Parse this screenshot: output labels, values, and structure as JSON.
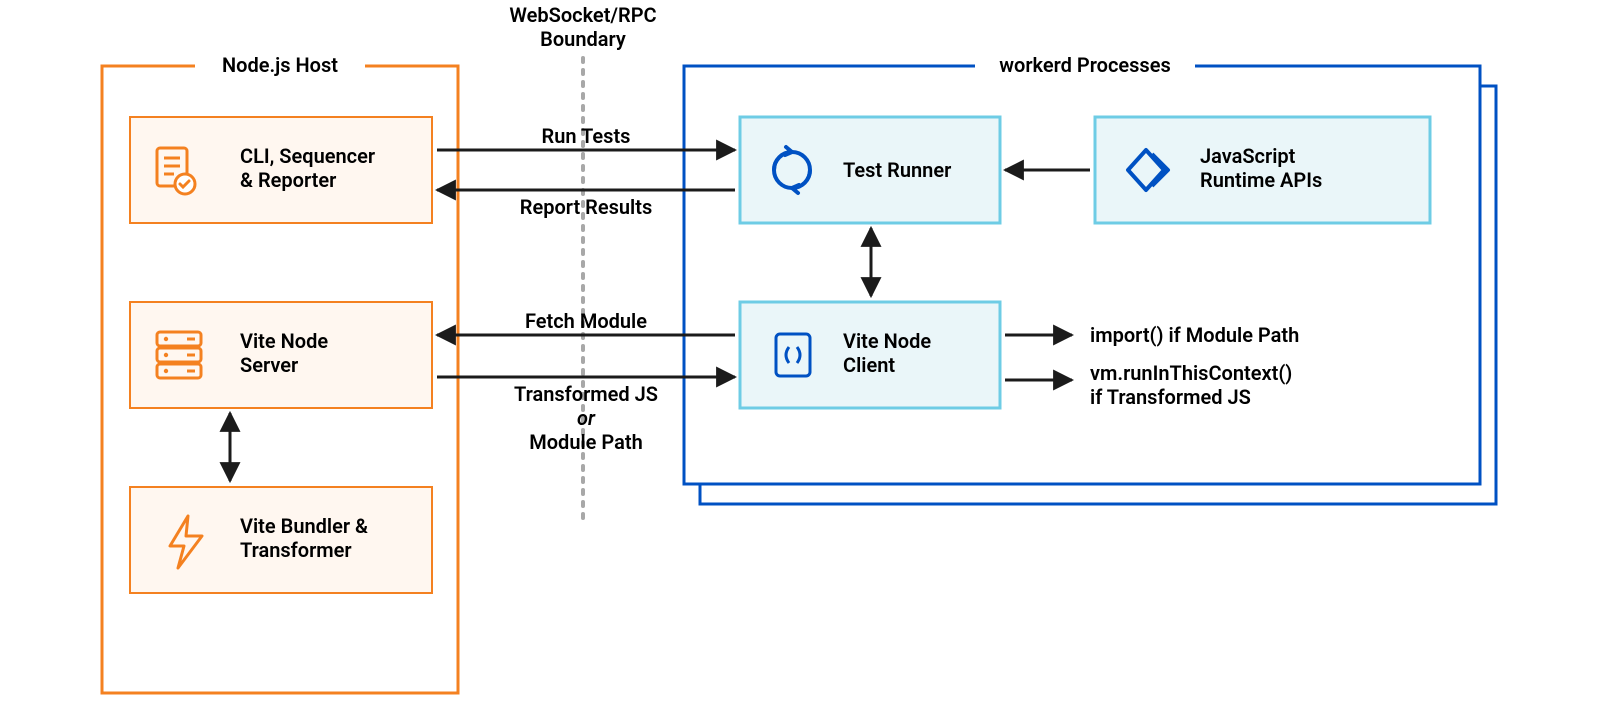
{
  "colors": {
    "orange": "#F48120",
    "orangeFill": "#FFF7F0",
    "blue": "#0051C3",
    "blueStroke": "#0051C3",
    "cyanStroke": "#6ECCE5",
    "cyanFill": "#EAF6F9",
    "black": "#1B1B1B",
    "grey": "#A8A8A8"
  },
  "boundary": {
    "title": "WebSocket/RPC",
    "subtitle": "Boundary"
  },
  "nodejs": {
    "title": "Node.js Host",
    "boxes": {
      "cli": "CLI, Sequencer & Reporter",
      "viteServer": "Vite Node Server",
      "bundler": "Vite Bundler & Transformer"
    }
  },
  "workerd": {
    "title": "workerd Processes",
    "boxes": {
      "testRunner": "Test Runner",
      "jsRuntime": "JavaScript Runtime APIs",
      "viteClient": "Vite Node Client"
    }
  },
  "arrows": {
    "runTests": "Run Tests",
    "reportResults": "Report Results",
    "fetchModule": "Fetch Module",
    "transformedJS": "Transformed JS",
    "or": "or",
    "modulePath": "Module Path",
    "importIf": "import() if Module Path",
    "vmRun": "vm.runInThisContext() if Transformed JS"
  }
}
